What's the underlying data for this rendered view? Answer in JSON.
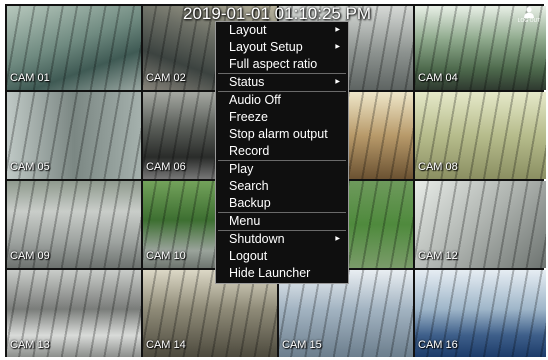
{
  "timestamp": "2019-01-01 01:10:25 PM",
  "logout_corner_label": "LOG OUT",
  "cameras": [
    {
      "label": "CAM 01"
    },
    {
      "label": "CAM 02"
    },
    {
      "label": ""
    },
    {
      "label": "CAM 04"
    },
    {
      "label": "CAM 05"
    },
    {
      "label": "CAM 06"
    },
    {
      "label": ""
    },
    {
      "label": "CAM 08"
    },
    {
      "label": "CAM 09"
    },
    {
      "label": "CAM 10"
    },
    {
      "label": ""
    },
    {
      "label": "CAM 12"
    },
    {
      "label": "CAM 13"
    },
    {
      "label": "CAM 14"
    },
    {
      "label": "CAM 15"
    },
    {
      "label": "CAM 16"
    }
  ],
  "menu": {
    "groups": [
      [
        {
          "label": "Layout",
          "submenu": true
        },
        {
          "label": "Layout Setup",
          "submenu": true
        },
        {
          "label": "Full aspect ratio",
          "submenu": false
        }
      ],
      [
        {
          "label": "Status",
          "submenu": true
        }
      ],
      [
        {
          "label": "Audio Off",
          "submenu": false
        },
        {
          "label": "Freeze",
          "submenu": false
        },
        {
          "label": "Stop alarm output",
          "submenu": false
        },
        {
          "label": "Record",
          "submenu": false
        }
      ],
      [
        {
          "label": "Play",
          "submenu": false
        },
        {
          "label": "Search",
          "submenu": false
        },
        {
          "label": "Backup",
          "submenu": false
        }
      ],
      [
        {
          "label": "Menu",
          "submenu": false
        }
      ],
      [
        {
          "label": "Shutdown",
          "submenu": true
        },
        {
          "label": "Logout",
          "submenu": false
        },
        {
          "label": "Hide Launcher",
          "submenu": false
        }
      ]
    ],
    "submenu_arrow": "▶"
  }
}
